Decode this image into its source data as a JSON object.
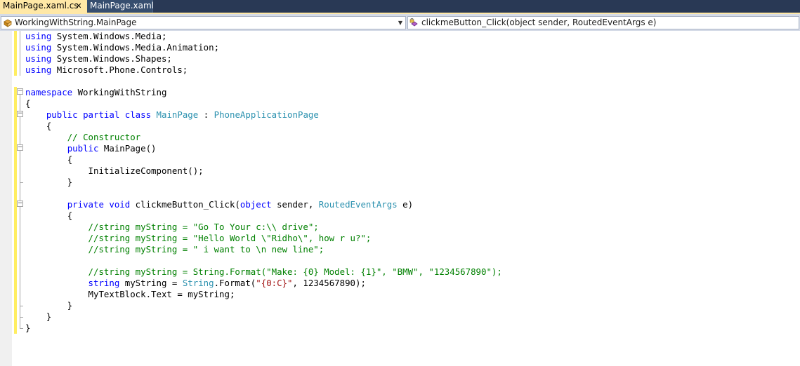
{
  "tabs": [
    {
      "label": "MainPage.xaml.cs",
      "active": true
    },
    {
      "label": "MainPage.xaml",
      "active": false
    }
  ],
  "nav": {
    "type_combo": "WorkingWithString.MainPage",
    "member_combo": "clickmeButton_Click(object sender, RoutedEventArgs e)"
  },
  "code": [
    {
      "indent": "",
      "tokens": [
        {
          "t": "kw",
          "v": "using"
        },
        {
          "t": "",
          "v": " System.Windows.Media;"
        }
      ]
    },
    {
      "indent": "",
      "tokens": [
        {
          "t": "kw",
          "v": "using"
        },
        {
          "t": "",
          "v": " System.Windows.Media.Animation;"
        }
      ]
    },
    {
      "indent": "",
      "tokens": [
        {
          "t": "kw",
          "v": "using"
        },
        {
          "t": "",
          "v": " System.Windows.Shapes;"
        }
      ]
    },
    {
      "indent": "",
      "tokens": [
        {
          "t": "kw",
          "v": "using"
        },
        {
          "t": "",
          "v": " Microsoft.Phone.Controls;"
        }
      ]
    },
    {
      "indent": "",
      "tokens": []
    },
    {
      "indent": "",
      "tokens": [
        {
          "t": "kw",
          "v": "namespace"
        },
        {
          "t": "",
          "v": " WorkingWithString"
        }
      ]
    },
    {
      "indent": "",
      "tokens": [
        {
          "t": "",
          "v": "{"
        }
      ]
    },
    {
      "indent": "    ",
      "tokens": [
        {
          "t": "kw",
          "v": "public"
        },
        {
          "t": "",
          "v": " "
        },
        {
          "t": "kw",
          "v": "partial"
        },
        {
          "t": "",
          "v": " "
        },
        {
          "t": "kw",
          "v": "class"
        },
        {
          "t": "",
          "v": " "
        },
        {
          "t": "ty",
          "v": "MainPage"
        },
        {
          "t": "",
          "v": " : "
        },
        {
          "t": "ty",
          "v": "PhoneApplicationPage"
        }
      ]
    },
    {
      "indent": "    ",
      "tokens": [
        {
          "t": "",
          "v": "{"
        }
      ]
    },
    {
      "indent": "        ",
      "tokens": [
        {
          "t": "cm",
          "v": "// Constructor"
        }
      ]
    },
    {
      "indent": "        ",
      "tokens": [
        {
          "t": "kw",
          "v": "public"
        },
        {
          "t": "",
          "v": " MainPage()"
        }
      ]
    },
    {
      "indent": "        ",
      "tokens": [
        {
          "t": "",
          "v": "{"
        }
      ]
    },
    {
      "indent": "            ",
      "tokens": [
        {
          "t": "",
          "v": "InitializeComponent();"
        }
      ]
    },
    {
      "indent": "        ",
      "tokens": [
        {
          "t": "",
          "v": "}"
        }
      ]
    },
    {
      "indent": "",
      "tokens": []
    },
    {
      "indent": "        ",
      "tokens": [
        {
          "t": "kw",
          "v": "private"
        },
        {
          "t": "",
          "v": " "
        },
        {
          "t": "kw",
          "v": "void"
        },
        {
          "t": "",
          "v": " clickmeButton_Click("
        },
        {
          "t": "kw",
          "v": "object"
        },
        {
          "t": "",
          "v": " sender, "
        },
        {
          "t": "ty",
          "v": "RoutedEventArgs"
        },
        {
          "t": "",
          "v": " e)"
        }
      ]
    },
    {
      "indent": "        ",
      "tokens": [
        {
          "t": "",
          "v": "{"
        }
      ]
    },
    {
      "indent": "            ",
      "tokens": [
        {
          "t": "cm",
          "v": "//string myString = \"Go To Your c:\\\\ drive\";"
        }
      ]
    },
    {
      "indent": "            ",
      "tokens": [
        {
          "t": "cm",
          "v": "//string myString = \"Hello World \\\"Ridho\\\", how r u?\";"
        }
      ]
    },
    {
      "indent": "            ",
      "tokens": [
        {
          "t": "cm",
          "v": "//string myString = \" i want to \\n new line\";"
        }
      ]
    },
    {
      "indent": "",
      "tokens": []
    },
    {
      "indent": "            ",
      "tokens": [
        {
          "t": "cm",
          "v": "//string myString = String.Format(\"Make: {0} Model: {1}\", \"BMW\", \"1234567890\");"
        }
      ]
    },
    {
      "indent": "            ",
      "tokens": [
        {
          "t": "kw",
          "v": "string"
        },
        {
          "t": "",
          "v": " myString = "
        },
        {
          "t": "ty",
          "v": "String"
        },
        {
          "t": "",
          "v": ".Format("
        },
        {
          "t": "st",
          "v": "\"{0:C}\""
        },
        {
          "t": "",
          "v": ", 1234567890);"
        }
      ]
    },
    {
      "indent": "            ",
      "tokens": [
        {
          "t": "",
          "v": "MyTextBlock.Text = myString;"
        }
      ]
    },
    {
      "indent": "        ",
      "tokens": [
        {
          "t": "",
          "v": "}"
        }
      ]
    },
    {
      "indent": "    ",
      "tokens": [
        {
          "t": "",
          "v": "}"
        }
      ]
    },
    {
      "indent": "",
      "tokens": [
        {
          "t": "",
          "v": "}"
        }
      ]
    }
  ]
}
